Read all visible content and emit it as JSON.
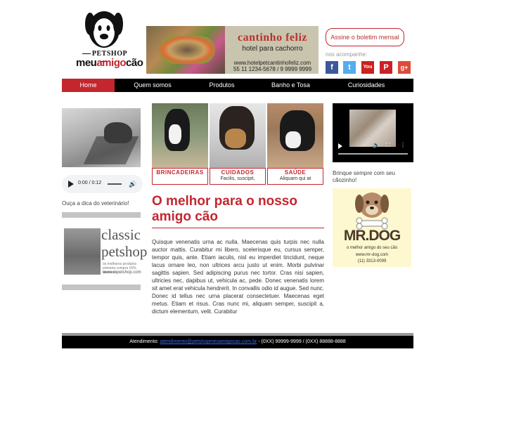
{
  "logo": {
    "petshop": "PETSHOP",
    "name_a": "meu",
    "name_b": "amigo",
    "name_c": "cão"
  },
  "banner": {
    "title": "cantinho feliz",
    "subtitle": "hotel para cachorro",
    "url": "www.hotelpetcantinhofeliz.com",
    "phone": "55 11 1234-5678 / 9 9999 9999"
  },
  "newsletter": {
    "label": "Assine o boletim mensal"
  },
  "follow": {
    "label": "nos acompanhe:"
  },
  "social": [
    {
      "name": "facebook",
      "glyph": "f",
      "color": "#3b5998"
    },
    {
      "name": "twitter",
      "glyph": "t",
      "color": "#55acee"
    },
    {
      "name": "youtube",
      "glyph": "You",
      "color": "#cd201f"
    },
    {
      "name": "pinterest",
      "glyph": "P",
      "color": "#cb2027"
    },
    {
      "name": "google-plus",
      "glyph": "g+",
      "color": "#dd4b39"
    }
  ],
  "nav": {
    "items": [
      {
        "label": "Home",
        "active": true
      },
      {
        "label": "Quem somos"
      },
      {
        "label": "Produtos"
      },
      {
        "label": "Banho e Tosa"
      },
      {
        "label": "Curiosidades"
      }
    ]
  },
  "audio": {
    "time": "0:00 / 0:12"
  },
  "vet_caption": "Ouça a dica do veterinário!",
  "left_ad": {
    "line1": "classic",
    "line2": "petshop",
    "tagline": "os melhores produtos primeira compra 15% desconto",
    "url": "www.cspetshop.com"
  },
  "cards": [
    {
      "title": "BRINCADEIRAS",
      "desc": ""
    },
    {
      "title": "CUIDADOS",
      "desc": "Facilis, suscipit,"
    },
    {
      "title": "SAÚDE",
      "desc": "Aliquam qui at"
    }
  ],
  "main": {
    "headline": "O melhor para o nosso amigo cão",
    "body": "Quisque venenatis urna ac nulla. Maecenas quis turpis nec nulla auctor mattis. Curabitur mi libero, scelerisque eu, cursus semper, tempor quis, ante. Etiam iaculis, nisl eu imperdiet tincidunt, neque lacus ornare leo, non ultrices arcu justo ut enim. Morbi pulvinar sagittis sapien. Sed adipiscing purus nec tortor. Cras nisi sapien, ultricies nec, dapibus ut, vehicula ac, pede. Donec venenatis lorem sit amet erat vehicula hendrerit. In convallis odio id augue. Sed nunc. Donec id tellus nec urna placerat consectetuer. Maecenas eget metus. Etiam et risus. Cras nunc mi, aliquam semper, suscipit a, dictum elementum, velit. Curabitur"
  },
  "video_caption": "Brinque sempre com seu cãozinho!",
  "mrdog": {
    "name": "MR.DOG",
    "tagline": "o melhor amigo do seu cão",
    "url": "www.mr-dog.com",
    "phone": "(11) 3313-0099"
  },
  "footer": {
    "prefix": "Atendimento:",
    "email": "atendimento@petshopmeuamigocao.com.br",
    "phones": " - (0XX) 99999-9999 / (0XX) 88888-8888"
  }
}
